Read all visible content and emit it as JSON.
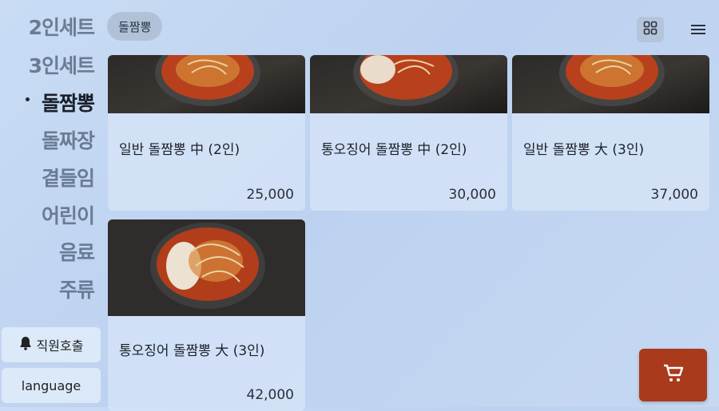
{
  "sidebar": {
    "categories": [
      {
        "label": "2인세트"
      },
      {
        "label": "3인세트"
      },
      {
        "label": "돌짬뽕"
      },
      {
        "label": "돌짜장"
      },
      {
        "label": "곁들임"
      },
      {
        "label": "어린이"
      },
      {
        "label": "음료"
      },
      {
        "label": "주류"
      }
    ],
    "staff_call": "직원호출",
    "language": "language"
  },
  "header": {
    "active_category": "돌짬뽕",
    "grid_icon": "grid-view-icon",
    "menu_icon": "hamburger-menu-icon"
  },
  "menu": {
    "items": [
      {
        "name": "일반 돌짬뽕 中 (2인)",
        "price": "25,000"
      },
      {
        "name": "통오징어 돌짬뽕 中 (2인)",
        "price": "30,000"
      },
      {
        "name": "일반 돌짬뽕 大 (3인)",
        "price": "37,000"
      },
      {
        "name": "통오징어 돌짬뽕 大 (3인)",
        "price": "42,000"
      }
    ]
  },
  "cart": {
    "icon": "cart-icon"
  },
  "colors": {
    "accent_cart": "#a93a1c",
    "active_text": "#1a1f2b",
    "inactive_text": "#6b7b94"
  }
}
